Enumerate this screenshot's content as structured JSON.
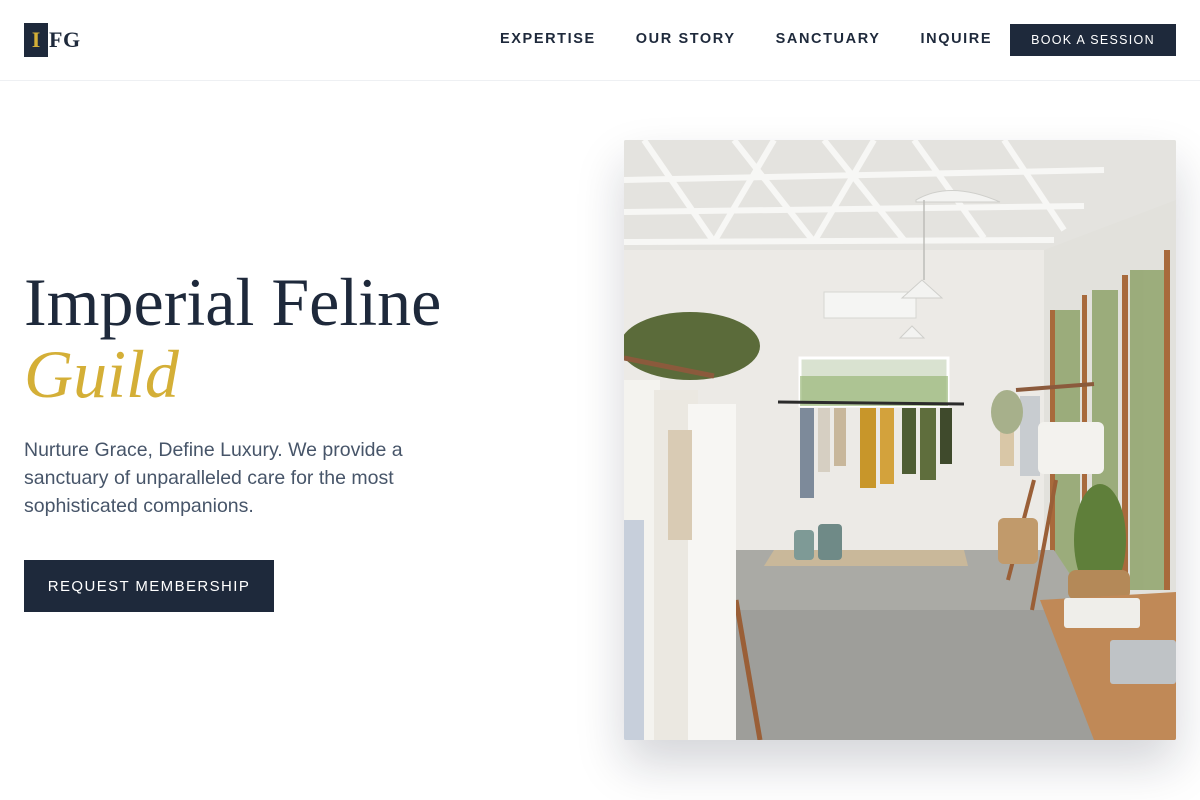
{
  "brand": {
    "logo_initial": "I",
    "logo_rest": "FG"
  },
  "nav": {
    "items": [
      "EXPERTISE",
      "OUR STORY",
      "SANCTUARY",
      "INQUIRE"
    ],
    "book_label": "BOOK A SESSION"
  },
  "hero": {
    "title_line1": "Imperial Feline",
    "title_line2": "Guild",
    "subtitle": "Nurture Grace, Define Luxury. We provide a sanctuary of unparalleled care for the most sophisticated companions.",
    "cta_label": "REQUEST MEMBERSHIP"
  },
  "colors": {
    "navy": "#1e293b",
    "gold": "#d4af37",
    "text_muted": "#475569"
  }
}
